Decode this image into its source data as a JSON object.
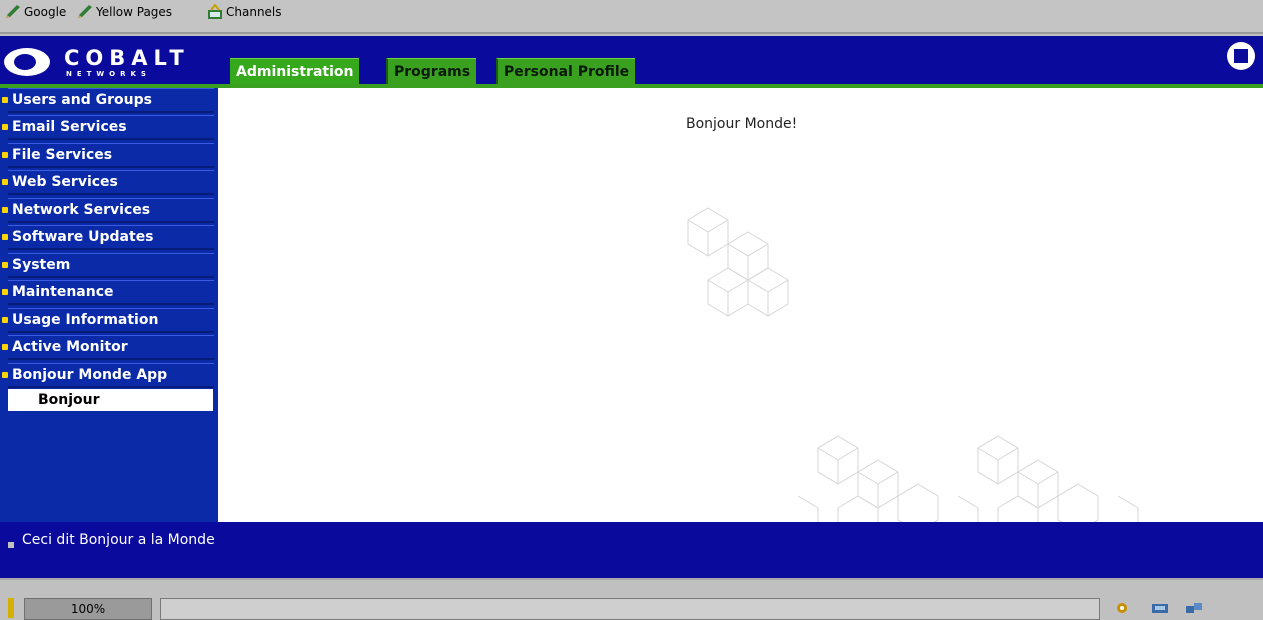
{
  "links_bar": {
    "items": [
      {
        "label": "Google",
        "icon": "pencil-link-icon"
      },
      {
        "label": "Yellow Pages",
        "icon": "pencil-link-icon"
      },
      {
        "label": "Channels",
        "icon": "channels-icon"
      }
    ]
  },
  "header": {
    "logo_word": "COBALT",
    "logo_sub": "NETWORKS",
    "tabs": [
      {
        "label": "Administration",
        "active": true
      },
      {
        "label": "Programs",
        "active": false
      },
      {
        "label": "Personal Profile",
        "active": false
      }
    ],
    "exit_icon": "exit-icon"
  },
  "sidebar": {
    "items": [
      {
        "label": "Users and Groups"
      },
      {
        "label": "Email Services"
      },
      {
        "label": "File Services"
      },
      {
        "label": "Web Services"
      },
      {
        "label": "Network Services"
      },
      {
        "label": "Software Updates"
      },
      {
        "label": "System"
      },
      {
        "label": "Maintenance"
      },
      {
        "label": "Usage Information"
      },
      {
        "label": "Active Monitor"
      },
      {
        "label": "Bonjour Monde App"
      }
    ],
    "selected_sub": "Bonjour"
  },
  "main": {
    "greeting": "Bonjour Monde!"
  },
  "info": {
    "text": "Ceci dit Bonjour a la Monde"
  },
  "statusbar": {
    "zoom": "100%"
  },
  "colors": {
    "header_blue": "#0a0a9c",
    "sidebar_blue": "#0a2aa8",
    "tab_green": "#3aa020"
  }
}
